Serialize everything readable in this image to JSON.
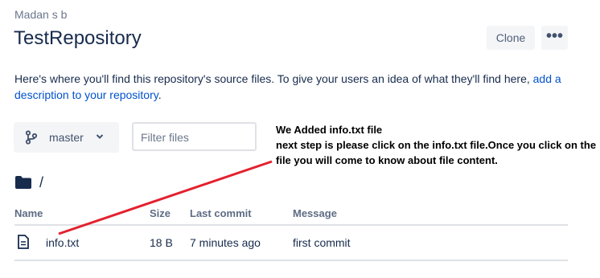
{
  "header": {
    "owner": "Madan s b",
    "repo_name": "TestRepository",
    "clone_label": "Clone",
    "more_label": "•••"
  },
  "description": {
    "text": "Here's where you'll find this repository's source files. To give your users an idea of what they'll find here, ",
    "link_text": "add a description to your repository",
    "suffix": "."
  },
  "toolbar": {
    "branch": "master",
    "filter_placeholder": "Filter files"
  },
  "path": "/",
  "table": {
    "columns": [
      "Name",
      "Size",
      "Last commit",
      "Message"
    ],
    "rows": [
      {
        "name": "info.txt",
        "size": "18 B",
        "last_commit": "7 minutes ago",
        "message": "first commit"
      }
    ]
  },
  "annotation": {
    "line1": "We Added info.txt file",
    "line2": "next step is please click on the info.txt file.Once you click on the file you will come to know about file content.",
    "color": "#e4202e"
  },
  "colors": {
    "text": "#172b4d",
    "link": "#0052cc",
    "button_bg": "#f4f5f7",
    "divider": "#dfe1e6"
  },
  "icons": {
    "branch": "git-branch-icon",
    "folder": "folder-icon",
    "file": "file-icon",
    "chevron": "chevron-down-icon"
  }
}
